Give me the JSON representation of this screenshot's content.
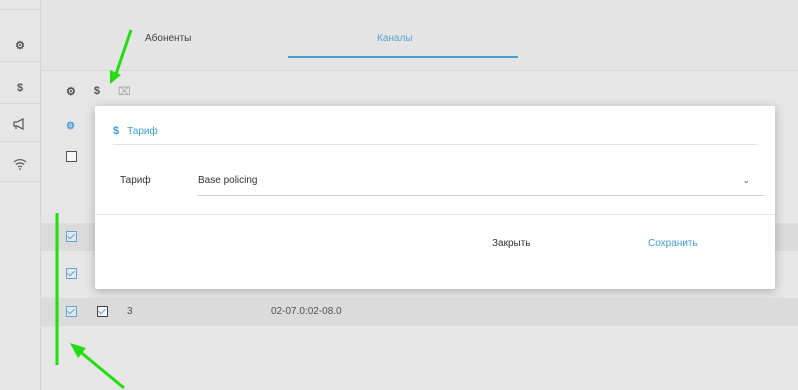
{
  "tabs": [
    {
      "label": "Абоненты"
    },
    {
      "label": "Каналы"
    }
  ],
  "sidebar": {
    "items": [
      {
        "icon": "gears-icon",
        "glyph": "⚙"
      },
      {
        "icon": "dollar-icon",
        "glyph": "$"
      },
      {
        "icon": "megaphone-icon",
        "glyph": "📢"
      },
      {
        "icon": "wifi-icon",
        "glyph": "≋"
      }
    ]
  },
  "toolbar": {
    "gears_glyph": "⚙",
    "dollar_glyph": "$",
    "delete_glyph": "⌧"
  },
  "table": {
    "visible_row": {
      "index": "3",
      "date_range": "02-07.0:02-08.0"
    }
  },
  "dialog": {
    "title": "Тариф",
    "title_icon": "$",
    "field_label": "Тариф",
    "select_value": "Base policing",
    "close_label": "Закрыть",
    "save_label": "Сохранить"
  },
  "colors": {
    "accent": "#3f9ed6",
    "annotation": "#22dd11"
  }
}
